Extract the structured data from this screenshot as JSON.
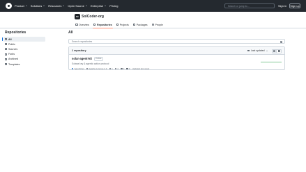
{
  "header": {
    "nav": [
      {
        "label": "Product"
      },
      {
        "label": "Solutions"
      },
      {
        "label": "Resources"
      },
      {
        "label": "Open Source"
      },
      {
        "label": "Enterprise"
      },
      {
        "label": "Pricing"
      }
    ],
    "search_placeholder": "Search or jump to...",
    "sign_in": "Sign in",
    "sign_up": "Sign up"
  },
  "org": {
    "name": "SolCoder-org",
    "avatar_text": "SC",
    "tabs": [
      {
        "label": "Overview",
        "icon": "book-icon"
      },
      {
        "label": "Repositories",
        "icon": "repo-icon"
      },
      {
        "label": "Projects",
        "icon": "table-icon"
      },
      {
        "label": "Packages",
        "icon": "package-icon"
      },
      {
        "label": "People",
        "icon": "person-icon"
      }
    ]
  },
  "sidebar": {
    "title": "Repositories",
    "items": [
      {
        "label": "All"
      },
      {
        "label": "Public"
      },
      {
        "label": "Sources"
      },
      {
        "label": "Forks"
      },
      {
        "label": "Archived"
      },
      {
        "label": "Templates"
      }
    ]
  },
  "main": {
    "heading": "All",
    "search_placeholder": "Search repositories",
    "count_label": "1 repository",
    "sort_label": "Last updated",
    "repos": [
      {
        "name": "solar-agent-kit",
        "visibility": "Public",
        "description": "Solana key & agentic action protocol",
        "language": "TypeScript",
        "license": "Apache License 2.0",
        "forks": "1",
        "stars": "2",
        "issues": "0",
        "pull_requests": "0",
        "updated": "Updated last week"
      }
    ]
  },
  "colors": {
    "header_bg": "#24292f",
    "active_tab_underline": "#fd8c73",
    "accent": "#0969da",
    "typescript": "#3178c6"
  }
}
